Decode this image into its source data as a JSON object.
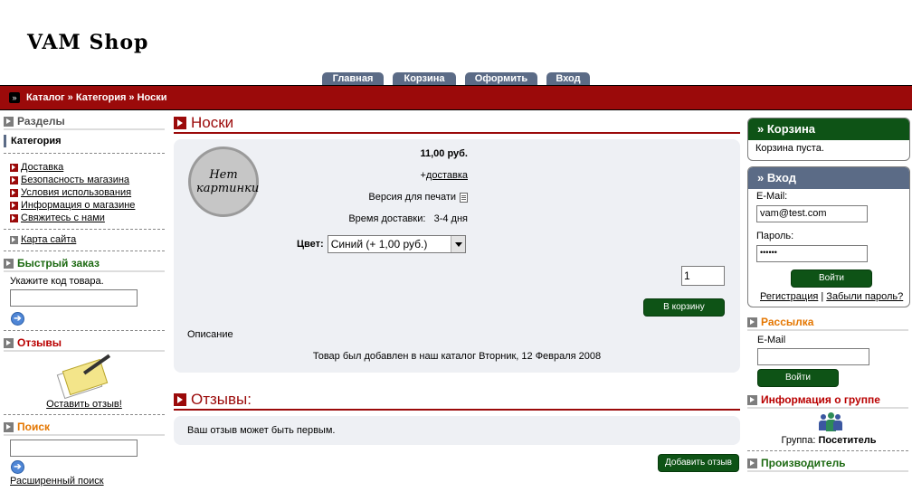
{
  "logo": "VAM Shop",
  "tabs": [
    "Главная",
    "Корзина",
    "Оформить",
    "Вход"
  ],
  "breadcrumb": "Каталог » Категория » Носки",
  "left": {
    "sections_title": "Разделы",
    "category": "Категория",
    "info_links": [
      "Доставка",
      "Безопасность магазина",
      "Условия использования",
      "Информация о магазине",
      "Свяжитесь с нами"
    ],
    "sitemap": "Карта сайта",
    "quick_title": "Быстрый заказ",
    "quick_label": "Укажите код товара.",
    "reviews_title": "Отзывы",
    "write_review": "Оставить отзыв!",
    "search_title": "Поиск",
    "advanced_search": "Расширенный поиск"
  },
  "product": {
    "title": "Носки",
    "no_image": "Нет картинки",
    "price": "11,00 руб.",
    "shipping_prefix": "+",
    "shipping": "доставка",
    "print_version": "Версия для печати",
    "delivery_label": "Время доставки:",
    "delivery_value": "3-4 дня",
    "color_label": "Цвет:",
    "color_selected": "Синий (+ 1,00 руб.)",
    "quantity": "1",
    "add_to_cart": "В корзину",
    "description_label": "Описание",
    "added_text": "Товар был добавлен в наш каталог Вторник, 12 Февраля 2008"
  },
  "reviews": {
    "title": "Отзывы:",
    "empty": "Ваш отзыв может быть первым.",
    "add_button": "Добавить отзыв"
  },
  "right": {
    "cart_title": "» Корзина",
    "cart_empty": "Корзина пуста.",
    "login_title": "» Вход",
    "email_label": "E-Mail:",
    "email_value": "vam@test.com",
    "password_label": "Пароль:",
    "password_value": "••••••",
    "login_button": "Войти",
    "register": "Регистрация",
    "separator": "|",
    "forgot": "Забыли пароль?",
    "newsletter_title": "Рассылка",
    "newsletter_email_label": "E-Mail",
    "newsletter_button": "Войти",
    "group_title": "Информация о группе",
    "group_label": "Группа:",
    "group_value": "Посетитель",
    "manufacturer_title": "Производитель"
  },
  "colors": {
    "brand_red": "#9b0a0a",
    "tab_blue": "#5b6b86",
    "button_green": "#0e5316"
  }
}
